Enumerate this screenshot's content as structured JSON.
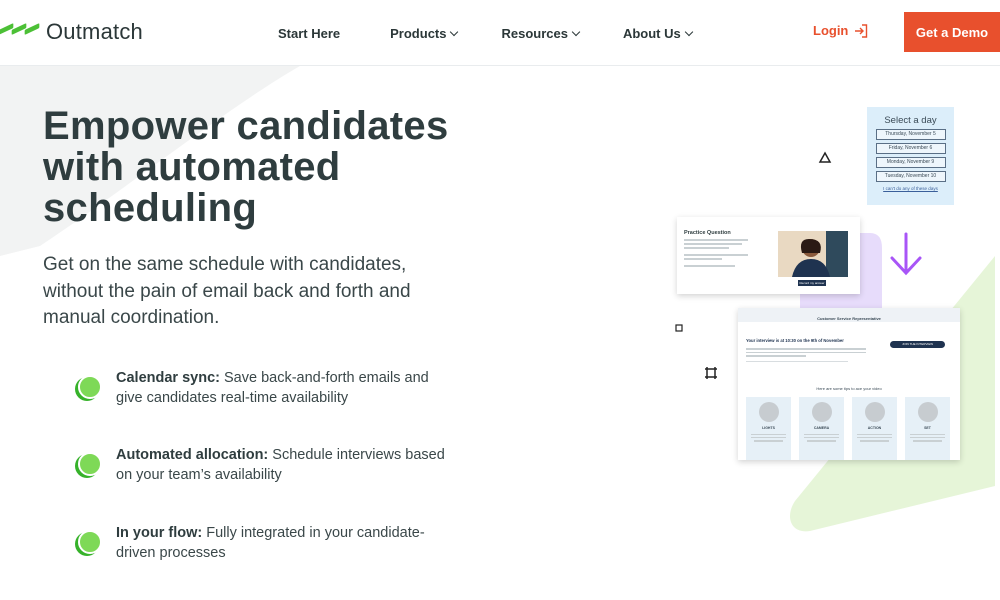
{
  "header": {
    "logo_text": "Outmatch",
    "nav": [
      {
        "label": "Start Here",
        "has_dropdown": false
      },
      {
        "label": "Products",
        "has_dropdown": true
      },
      {
        "label": "Resources",
        "has_dropdown": true
      },
      {
        "label": "About Us",
        "has_dropdown": true
      }
    ],
    "login_label": "Login",
    "demo_label": "Get a Demo"
  },
  "hero": {
    "title_lines": [
      "Empower candidates",
      "with automated",
      "scheduling"
    ],
    "subtitle_lines": [
      "Get on the same schedule with candidates,",
      "without the pain of email back and forth and",
      "manual coordination."
    ]
  },
  "features": [
    {
      "title": "Calendar sync:",
      "line1": "Save back-and-forth emails and",
      "line2": "give candidates real-time availability"
    },
    {
      "title": "Automated allocation:",
      "line1": "Schedule interviews based",
      "line2": "on your team’s availability"
    },
    {
      "title": "In your flow:",
      "line1": "Fully integrated in your candidate-",
      "line2": "driven processes"
    }
  ],
  "illustration": {
    "day_picker": {
      "title": "Select a day",
      "options": [
        "Thursday, November 5",
        "Friday, November 6",
        "Monday, November 9",
        "Tuesday, November 10"
      ],
      "none_link": "I can't do any of these days"
    },
    "practice_card": {
      "heading": "Practice Question",
      "button": "Record my answer"
    },
    "interview_card": {
      "header": "Customer Service Representative",
      "interview_line": "Your interview is at 10:30 on the 9th of November",
      "join_button": "JOIN THE INTERVIEW",
      "tips_title": "Here are some tips to ace your video",
      "tips": [
        "LIGHTS",
        "CAMERA",
        "ACTION",
        "SET"
      ]
    }
  },
  "colors": {
    "accent": "#e8502d",
    "brand_green": "#4cc036",
    "text_dark": "#2f3d3f",
    "arrow_purple": "#a855f7"
  }
}
